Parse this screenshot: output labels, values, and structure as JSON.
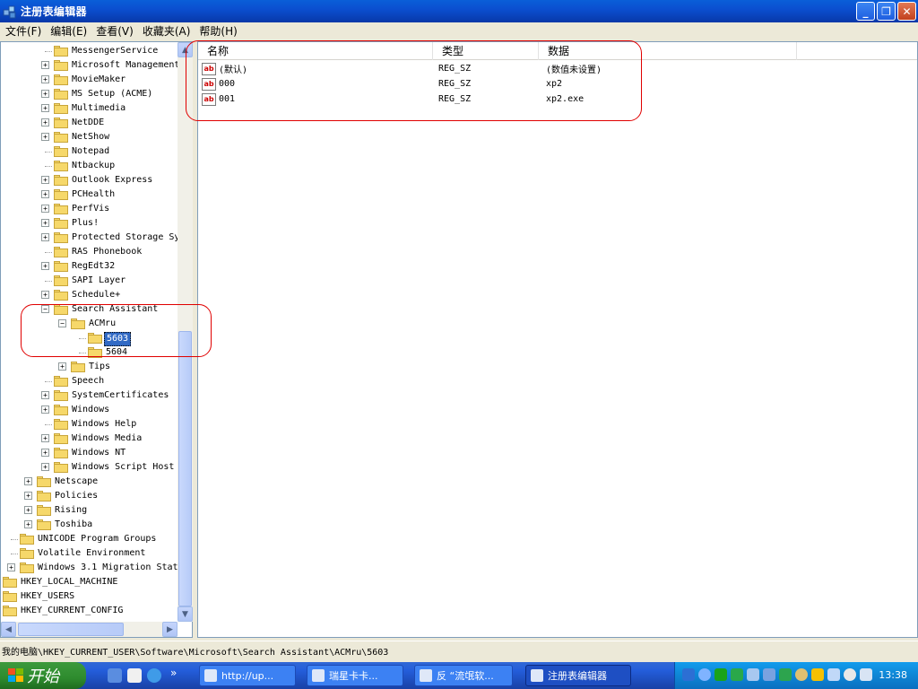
{
  "window": {
    "title": "注册表编辑器"
  },
  "menu": [
    "文件(F)",
    "编辑(E)",
    "查看(V)",
    "收藏夹(A)",
    "帮助(H)"
  ],
  "tree": {
    "items": [
      {
        "label": "MessengerService",
        "level": 2,
        "expander": "none"
      },
      {
        "label": "Microsoft Management",
        "level": 2,
        "expander": "plus"
      },
      {
        "label": "MovieMaker",
        "level": 2,
        "expander": "plus"
      },
      {
        "label": "MS Setup (ACME)",
        "level": 2,
        "expander": "plus"
      },
      {
        "label": "Multimedia",
        "level": 2,
        "expander": "plus"
      },
      {
        "label": "NetDDE",
        "level": 2,
        "expander": "plus"
      },
      {
        "label": "NetShow",
        "level": 2,
        "expander": "plus"
      },
      {
        "label": "Notepad",
        "level": 2,
        "expander": "none"
      },
      {
        "label": "Ntbackup",
        "level": 2,
        "expander": "none"
      },
      {
        "label": "Outlook Express",
        "level": 2,
        "expander": "plus"
      },
      {
        "label": "PCHealth",
        "level": 2,
        "expander": "plus"
      },
      {
        "label": "PerfVis",
        "level": 2,
        "expander": "plus"
      },
      {
        "label": "Plus!",
        "level": 2,
        "expander": "plus"
      },
      {
        "label": "Protected Storage Sy",
        "level": 2,
        "expander": "plus"
      },
      {
        "label": "RAS Phonebook",
        "level": 2,
        "expander": "none"
      },
      {
        "label": "RegEdt32",
        "level": 2,
        "expander": "plus"
      },
      {
        "label": "SAPI Layer",
        "level": 2,
        "expander": "none"
      },
      {
        "label": "Schedule+",
        "level": 2,
        "expander": "plus"
      },
      {
        "label": "Search Assistant",
        "level": 2,
        "expander": "minus"
      },
      {
        "label": "ACMru",
        "level": 3,
        "expander": "minus"
      },
      {
        "label": "5603",
        "level": 4,
        "expander": "none",
        "selected": true
      },
      {
        "label": "5604",
        "level": 4,
        "expander": "none"
      },
      {
        "label": "Tips",
        "level": 3,
        "expander": "plus"
      },
      {
        "label": "Speech",
        "level": 2,
        "expander": "none"
      },
      {
        "label": "SystemCertificates",
        "level": 2,
        "expander": "plus"
      },
      {
        "label": "Windows",
        "level": 2,
        "expander": "plus"
      },
      {
        "label": "Windows Help",
        "level": 2,
        "expander": "none"
      },
      {
        "label": "Windows Media",
        "level": 2,
        "expander": "plus"
      },
      {
        "label": "Windows NT",
        "level": 2,
        "expander": "plus"
      },
      {
        "label": "Windows Script Host",
        "level": 2,
        "expander": "plus"
      },
      {
        "label": "Netscape",
        "level": 1,
        "expander": "plus"
      },
      {
        "label": "Policies",
        "level": 1,
        "expander": "plus"
      },
      {
        "label": "Rising",
        "level": 1,
        "expander": "plus"
      },
      {
        "label": "Toshiba",
        "level": 1,
        "expander": "plus"
      },
      {
        "label": "UNICODE Program Groups",
        "level": 0,
        "expander": "none"
      },
      {
        "label": "Volatile Environment",
        "level": 0,
        "expander": "none"
      },
      {
        "label": "Windows 3.1 Migration Stat",
        "level": 0,
        "expander": "plus"
      },
      {
        "label": "HKEY_LOCAL_MACHINE",
        "level": -1,
        "expander": "none"
      },
      {
        "label": "HKEY_USERS",
        "level": -1,
        "expander": "none"
      },
      {
        "label": "HKEY_CURRENT_CONFIG",
        "level": -1,
        "expander": "none"
      }
    ]
  },
  "list": {
    "columns": [
      "名称",
      "类型",
      "数据"
    ],
    "rows": [
      {
        "name": "(默认)",
        "type": "REG_SZ",
        "data": "(数值未设置)"
      },
      {
        "name": "000",
        "type": "REG_SZ",
        "data": "xp2"
      },
      {
        "name": "001",
        "type": "REG_SZ",
        "data": "xp2.exe"
      }
    ]
  },
  "status": {
    "path": "我的电脑\\HKEY_CURRENT_USER\\Software\\Microsoft\\Search Assistant\\ACMru\\5603"
  },
  "taskbar": {
    "start_label": "开始",
    "overflow": "»",
    "tasks": [
      {
        "label": "http://up..."
      },
      {
        "label": "瑞星卡卡..."
      },
      {
        "label": "反 “流氓软..."
      },
      {
        "label": "注册表编辑器",
        "active": true
      }
    ],
    "clock": "13:38"
  },
  "colors": {
    "annotation": "#e00000",
    "selection": "#316ac5"
  }
}
